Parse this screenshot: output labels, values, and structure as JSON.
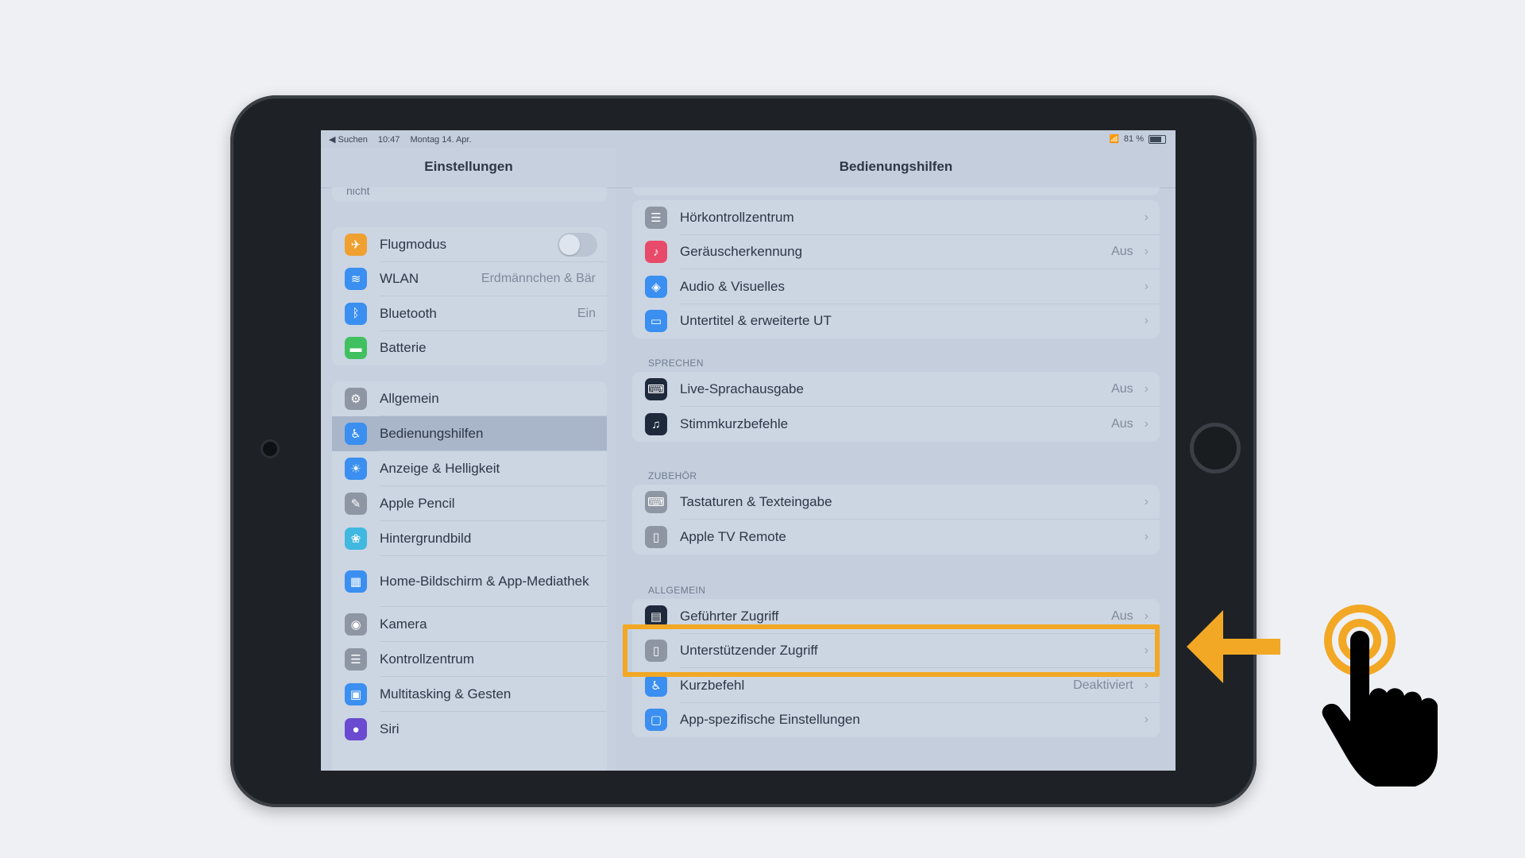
{
  "status_bar": {
    "back_label": "◀ Suchen",
    "time": "10:47",
    "date": "Montag 14. Apr.",
    "battery": "81 %"
  },
  "sidebar": {
    "title": "Einstellungen",
    "truncated_top": "nicht",
    "group1": [
      {
        "label": "Flugmodus",
        "icon": "airplane-icon",
        "color": "#f0a030",
        "value": ""
      },
      {
        "label": "WLAN",
        "icon": "wifi-icon",
        "color": "#3a8ff0",
        "value": "Erdmännchen & Bär"
      },
      {
        "label": "Bluetooth",
        "icon": "bluetooth-icon",
        "color": "#3a8ff0",
        "value": "Ein"
      },
      {
        "label": "Batterie",
        "icon": "battery-icon",
        "color": "#40c060",
        "value": ""
      }
    ],
    "group2": [
      {
        "label": "Allgemein",
        "icon": "gear-icon",
        "color": "#8e96a3"
      },
      {
        "label": "Bedienungshilfen",
        "icon": "accessibility-icon",
        "color": "#3a8ff0"
      },
      {
        "label": "Anzeige & Helligkeit",
        "icon": "brightness-icon",
        "color": "#3a8ff0"
      },
      {
        "label": "Apple Pencil",
        "icon": "pencil-icon",
        "color": "#8e96a3"
      },
      {
        "label": "Hintergrundbild",
        "icon": "wallpaper-icon",
        "color": "#40b8e0"
      },
      {
        "label": "Home-Bildschirm & App-Mediathek",
        "icon": "home-screen-icon",
        "color": "#3a8ff0"
      },
      {
        "label": "Kamera",
        "icon": "camera-icon",
        "color": "#8e96a3"
      },
      {
        "label": "Kontrollzentrum",
        "icon": "control-center-icon",
        "color": "#8e96a3"
      },
      {
        "label": "Multitasking & Gesten",
        "icon": "multitasking-icon",
        "color": "#3a8ff0"
      },
      {
        "label": "Siri",
        "icon": "siri-icon",
        "color": "#6a4ad0"
      }
    ]
  },
  "detail": {
    "title": "Bedienungshilfen",
    "group_hearing": [
      {
        "label": "Hörkontrollzentrum",
        "icon": "control-center-icon",
        "color": "#8e96a3",
        "value": ""
      },
      {
        "label": "Geräuscherkennung",
        "icon": "sound-recognition-icon",
        "color": "#e84a6a",
        "value": "Aus"
      },
      {
        "label": "Audio & Visuelles",
        "icon": "audio-visual-icon",
        "color": "#3a8ff0",
        "value": ""
      },
      {
        "label": "Untertitel & erweiterte UT",
        "icon": "subtitles-icon",
        "color": "#3a8ff0",
        "value": ""
      }
    ],
    "section_speak": "SPRECHEN",
    "group_speak": [
      {
        "label": "Live-Sprachausgabe",
        "icon": "live-speech-icon",
        "color": "#1e2a3c",
        "value": "Aus"
      },
      {
        "label": "Stimmkurzbefehle",
        "icon": "vocal-shortcuts-icon",
        "color": "#1e2a3c",
        "value": "Aus"
      }
    ],
    "section_accessories": "ZUBEHÖR",
    "group_accessories": [
      {
        "label": "Tastaturen & Texteingabe",
        "icon": "keyboard-icon",
        "color": "#8e96a3",
        "value": ""
      },
      {
        "label": "Apple TV Remote",
        "icon": "remote-icon",
        "color": "#8e96a3",
        "value": ""
      }
    ],
    "section_general": "ALLGEMEIN",
    "group_general": [
      {
        "label": "Geführter Zugriff",
        "icon": "guided-access-icon",
        "color": "#1e2a3c",
        "value": "Aus"
      },
      {
        "label": "Unterstützender Zugriff",
        "icon": "assistive-access-icon",
        "color": "#8e96a3",
        "value": ""
      },
      {
        "label": "Kurzbefehl",
        "icon": "accessibility-icon",
        "color": "#3a8ff0",
        "value": "Deaktiviert"
      },
      {
        "label": "App-spezifische Einstellungen",
        "icon": "app-settings-icon",
        "color": "#3a8ff0",
        "value": ""
      }
    ]
  },
  "annotation": {
    "highlight_color": "#f2a824"
  }
}
